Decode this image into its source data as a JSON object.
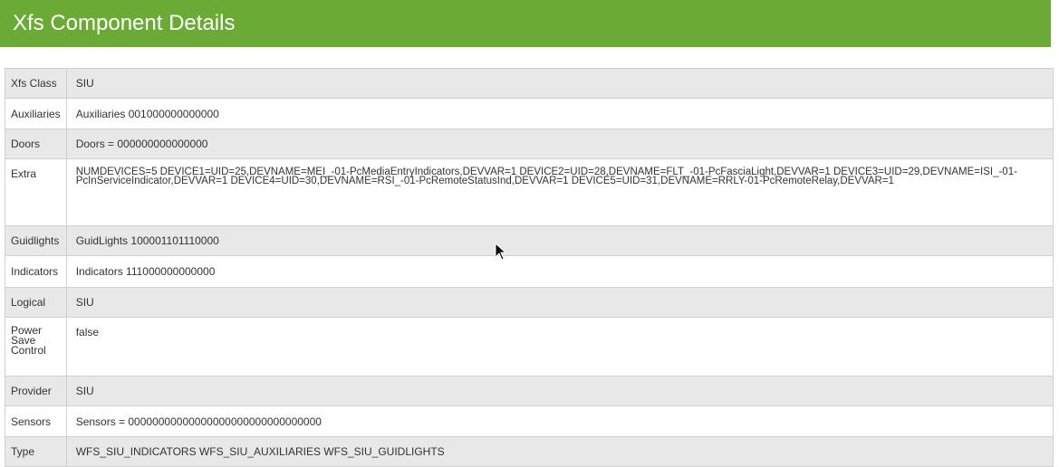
{
  "header": {
    "title": "Xfs Component Details",
    "color": "#6aab36"
  },
  "rows": [
    {
      "key": "Xfs Class",
      "value": "SIU"
    },
    {
      "key": "Auxiliaries",
      "value": "Auxiliaries 001000000000000"
    },
    {
      "key": "Doors",
      "value": "Doors = 000000000000000"
    },
    {
      "key": "Extra",
      "value": "NUMDEVICES=5 DEVICE1=UID=25,DEVNAME=MEI_-01-PcMediaEntryIndicators,DEVVAR=1 DEVICE2=UID=28,DEVNAME=FLT_-01-PcFasciaLight,DEVVAR=1 DEVICE3=UID=29,DEVNAME=ISI_-01-PcInServiceIndicator,DEVVAR=1 DEVICE4=UID=30,DEVNAME=RSI_-01-PcRemoteStatusInd,DEVVAR=1 DEVICE5=UID=31,DEVNAME=RRLY-01-PcRemoteRelay,DEVVAR=1"
    },
    {
      "key": "Guidlights",
      "value": "GuidLights 100001101110000"
    },
    {
      "key": "Indicators",
      "value": "Indicators 111000000000000"
    },
    {
      "key": "Logical",
      "value": "SIU"
    },
    {
      "key": "Power Save Control",
      "value": "false"
    },
    {
      "key": "Provider",
      "value": "SIU"
    },
    {
      "key": "Sensors",
      "value": "Sensors = 00000000000000000000000000000000"
    },
    {
      "key": "Type",
      "value": "WFS_SIU_INDICATORS WFS_SIU_AUXILIARIES WFS_SIU_GUIDLIGHTS"
    }
  ],
  "cursor": "mouse-pointer-icon"
}
